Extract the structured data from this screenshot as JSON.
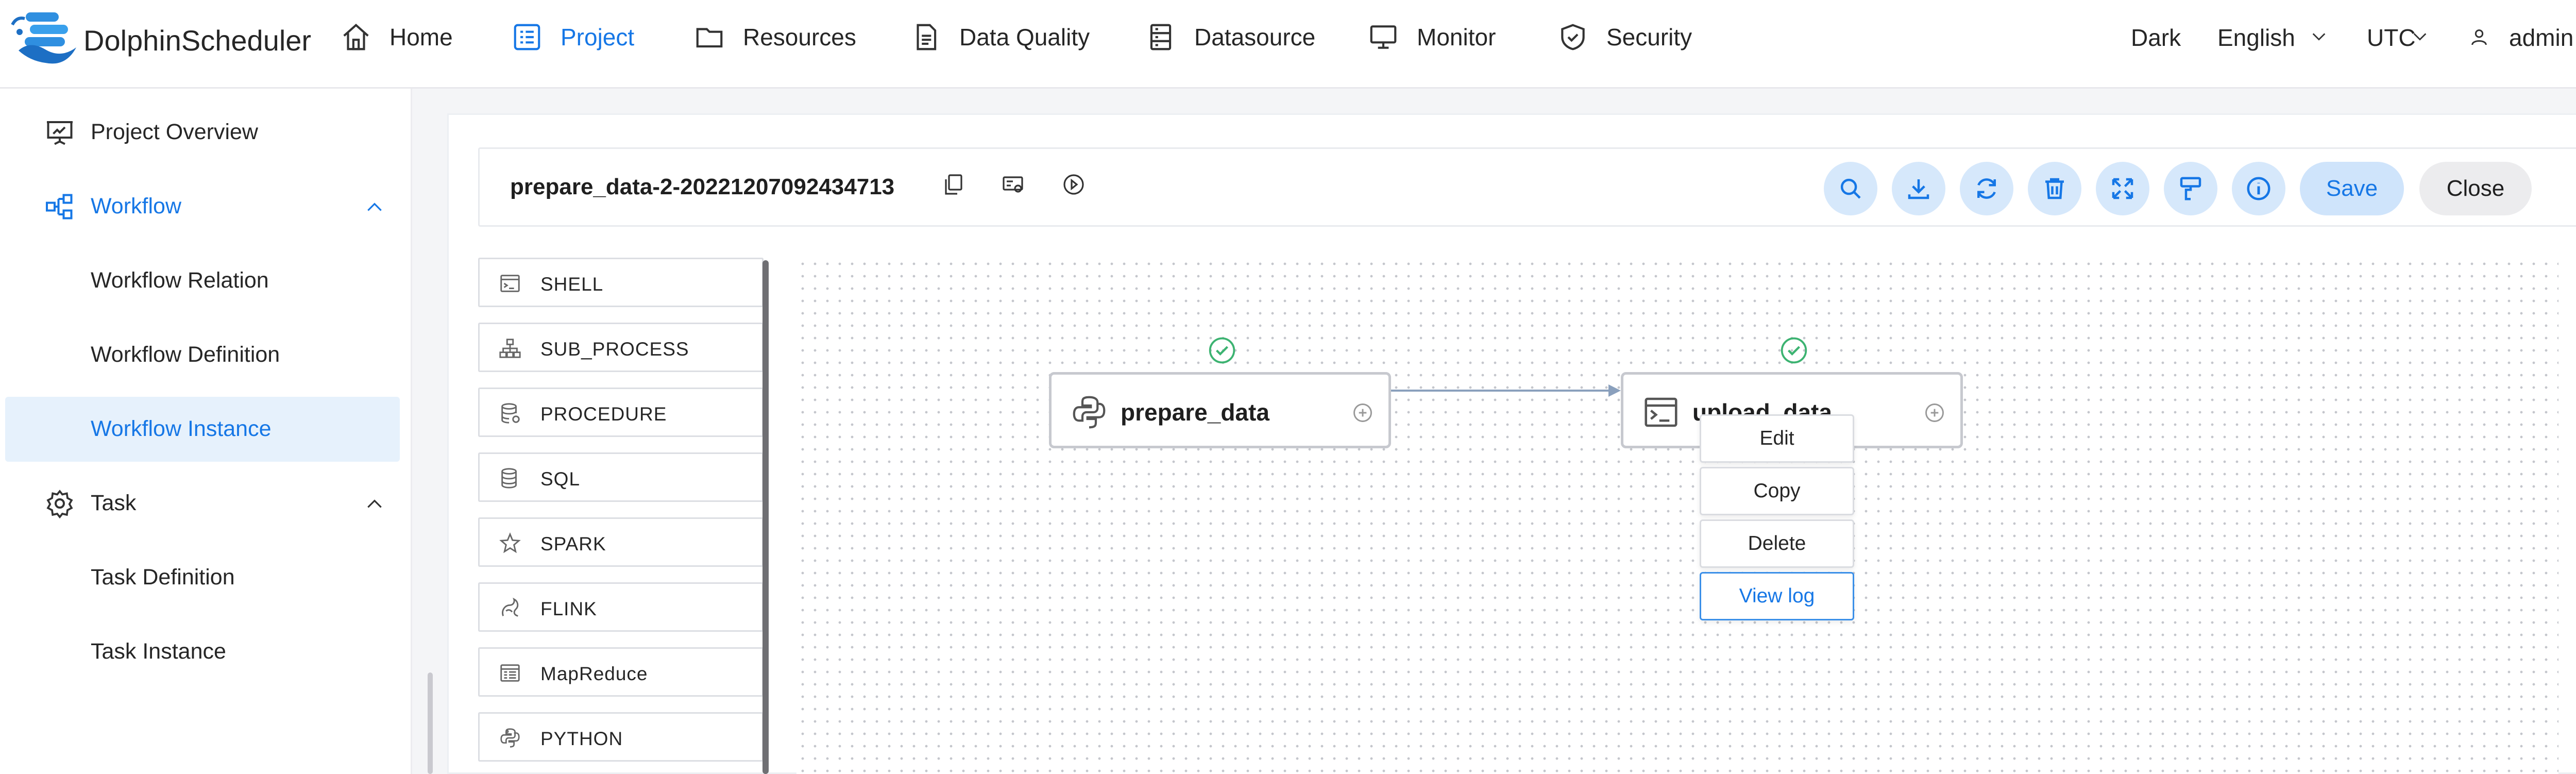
{
  "app": {
    "brand": "DolphinScheduler"
  },
  "nav": {
    "items": [
      {
        "label": "Home",
        "icon": "home-icon"
      },
      {
        "label": "Project",
        "icon": "project-icon",
        "active": true
      },
      {
        "label": "Resources",
        "icon": "folder-icon"
      },
      {
        "label": "Data Quality",
        "icon": "document-icon"
      },
      {
        "label": "Datasource",
        "icon": "database-icon"
      },
      {
        "label": "Monitor",
        "icon": "monitor-icon"
      },
      {
        "label": "Security",
        "icon": "shield-icon"
      }
    ],
    "theme": "Dark",
    "language": "English",
    "timezone": "UTC",
    "user": "admin"
  },
  "sidebar": {
    "items": [
      {
        "label": "Project Overview",
        "icon": "presentation-icon"
      },
      {
        "label": "Workflow",
        "icon": "workflow-icon",
        "expanded": true
      },
      {
        "label": "Workflow Relation"
      },
      {
        "label": "Workflow Definition"
      },
      {
        "label": "Workflow Instance",
        "active": true
      },
      {
        "label": "Task",
        "icon": "gear-icon",
        "expanded": true
      },
      {
        "label": "Task Definition"
      },
      {
        "label": "Task Instance"
      }
    ]
  },
  "toolbar": {
    "workflow_name": "prepare_data-2-20221207092434713",
    "actions": [
      "search-icon",
      "download-icon",
      "refresh-icon",
      "trash-icon",
      "fullscreen-icon",
      "format-brush-icon",
      "info-icon"
    ],
    "save_label": "Save",
    "close_label": "Close"
  },
  "palette": {
    "items": [
      {
        "label": "SHELL",
        "icon": "terminal-icon"
      },
      {
        "label": "SUB_PROCESS",
        "icon": "hierarchy-icon"
      },
      {
        "label": "PROCEDURE",
        "icon": "database-icon"
      },
      {
        "label": "SQL",
        "icon": "database-icon"
      },
      {
        "label": "SPARK",
        "icon": "star-icon"
      },
      {
        "label": "FLINK",
        "icon": "flink-icon"
      },
      {
        "label": "MapReduce",
        "icon": "mapreduce-icon"
      },
      {
        "label": "PYTHON",
        "icon": "python-icon"
      }
    ]
  },
  "canvas": {
    "nodes": [
      {
        "name": "prepare_data",
        "icon": "python-icon",
        "status": "success"
      },
      {
        "name": "upload_data",
        "icon": "terminal-icon",
        "status": "success"
      }
    ]
  },
  "context_menu": {
    "items": [
      "Edit",
      "Copy",
      "Delete",
      "View log"
    ]
  },
  "colors": {
    "accent": "#1677e6",
    "success": "#3cb371",
    "active_bg": "#e6f1fc"
  }
}
